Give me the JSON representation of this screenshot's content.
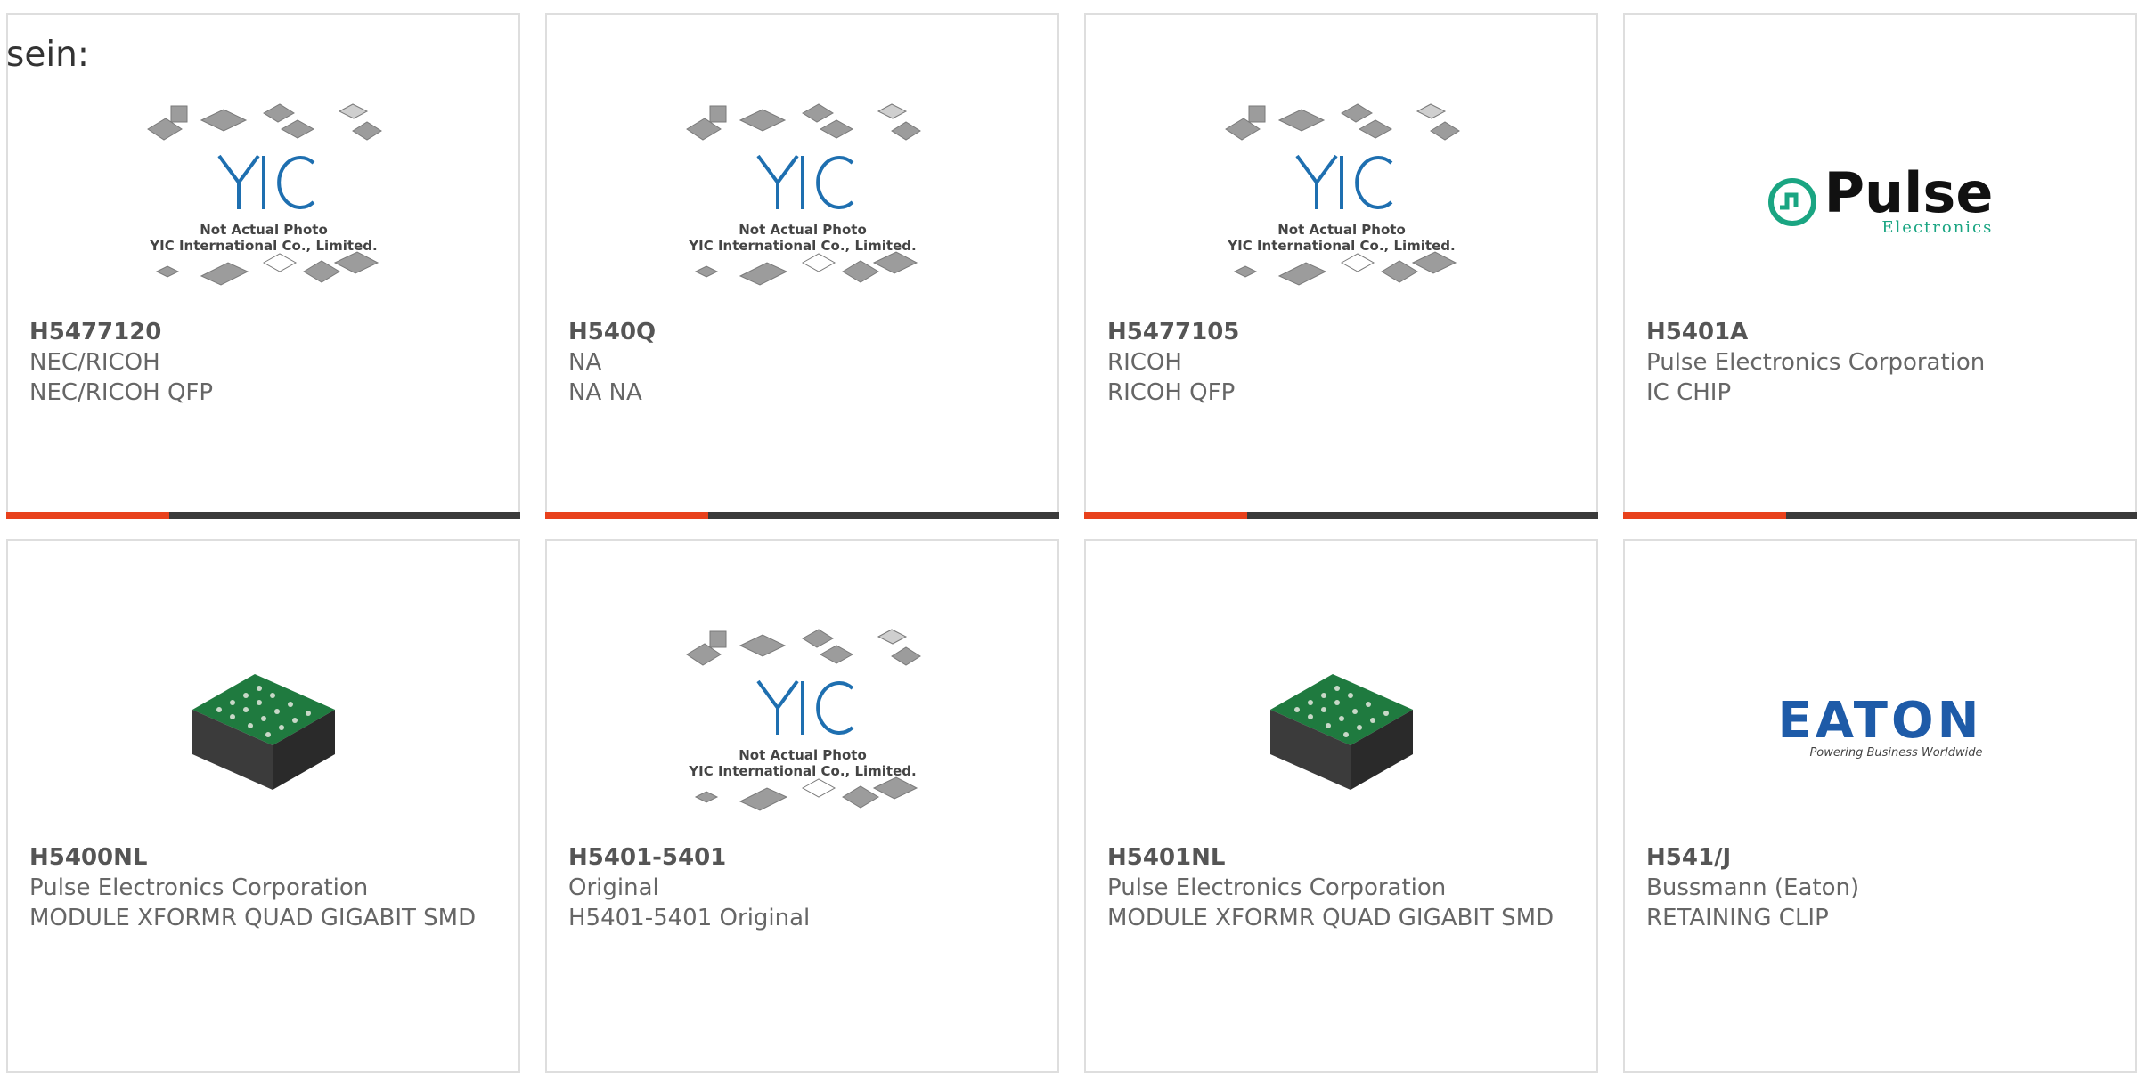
{
  "prefix_text": "sein:",
  "colors": {
    "accent_bar": "#e8411c",
    "dark_bar": "#3a3a3a",
    "card_border": "#dedede",
    "yic_blue": "#1e6fb0",
    "pulse_green": "#1aa582",
    "eaton_blue": "#1e5ba8"
  },
  "placeholder": {
    "line1": "Not Actual Photo",
    "line2": "YIC International Co., Limited."
  },
  "products": [
    {
      "part_no": "H5477120",
      "maker": "NEC/RICOH",
      "desc": "NEC/RICOH QFP",
      "image": "yic-placeholder-icon"
    },
    {
      "part_no": "H540Q",
      "maker": "NA",
      "desc": "NA NA",
      "image": "yic-placeholder-icon"
    },
    {
      "part_no": "H5477105",
      "maker": "RICOH",
      "desc": "RICOH QFP",
      "image": "yic-placeholder-icon"
    },
    {
      "part_no": "H5401A",
      "maker": "Pulse Electronics Corporation",
      "desc": "IC CHIP",
      "image": "pulse-logo"
    },
    {
      "part_no": "H5400NL",
      "maker": "Pulse Electronics Corporation",
      "desc": "MODULE XFORMR QUAD GIGABIT SMD",
      "image": "module-photo"
    },
    {
      "part_no": "H5401-5401",
      "maker": "Original",
      "desc": "H5401-5401 Original",
      "image": "yic-placeholder-icon"
    },
    {
      "part_no": "H5401NL",
      "maker": "Pulse Electronics Corporation",
      "desc": "MODULE XFORMR QUAD GIGABIT SMD",
      "image": "module-photo"
    },
    {
      "part_no": "H541/J",
      "maker": "Bussmann (Eaton)",
      "desc": "RETAINING CLIP",
      "image": "eaton-logo"
    }
  ],
  "pulse_logo": {
    "word": "Pulse",
    "sub": "Electronics"
  },
  "eaton_logo": {
    "word": "EATON",
    "tagline": "Powering Business Worldwide"
  }
}
